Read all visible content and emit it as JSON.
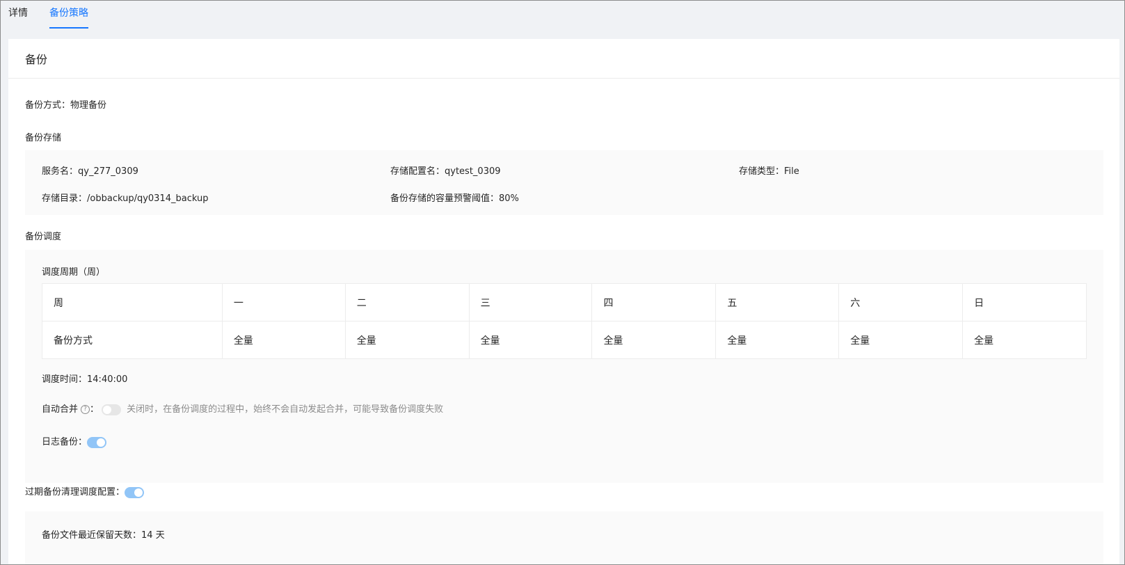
{
  "tabs": [
    {
      "label": "详情"
    },
    {
      "label": "备份策略"
    }
  ],
  "card": {
    "title": "备份"
  },
  "backup_method": {
    "label": "备份方式：",
    "value": "物理备份"
  },
  "storage": {
    "section_title": "备份存储",
    "service_name": {
      "label": "服务名：",
      "value": "qy_277_0309"
    },
    "config_name": {
      "label": "存储配置名：",
      "value": "qytest_0309"
    },
    "storage_type": {
      "label": "存储类型：",
      "value": "File"
    },
    "directory": {
      "label": "存储目录：",
      "value": "/obbackup/qy0314_backup"
    },
    "threshold": {
      "label": "备份存储的容量预警阈值：",
      "value": "80%"
    }
  },
  "schedule": {
    "section_title": "备份调度",
    "cycle_title": "调度周期（周）",
    "table": {
      "header": [
        "周",
        "一",
        "二",
        "三",
        "四",
        "五",
        "六",
        "日"
      ],
      "row": [
        "备份方式",
        "全量",
        "全量",
        "全量",
        "全量",
        "全量",
        "全量",
        "全量"
      ]
    },
    "time": {
      "label": "调度时间：",
      "value": "14:40:00"
    },
    "auto_merge": {
      "label": "自动合并",
      "colon": "：",
      "help": "?",
      "enabled": false,
      "hint": "关闭时，在备份调度的过程中，始终不会自动发起合并，可能导致备份调度失败"
    },
    "log_backup": {
      "label": "日志备份：",
      "enabled": true
    }
  },
  "cleanup": {
    "label": "过期备份清理调度配置：",
    "enabled": true,
    "retention": {
      "label": "备份文件最近保留天数：",
      "value": "14 天"
    }
  },
  "colors": {
    "accent": "#1677ff",
    "toggle_on": "#91c5f7",
    "toggle_off": "#e6e6e6"
  }
}
